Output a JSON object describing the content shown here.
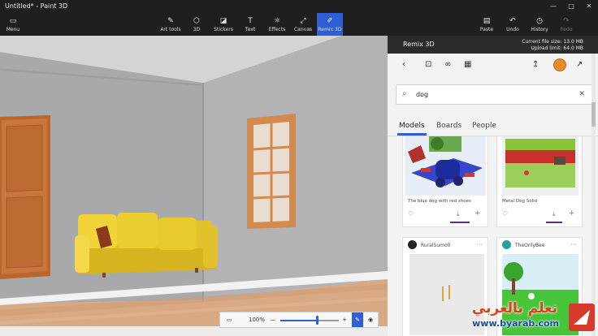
{
  "window": {
    "title": "Untitled* - Paint 3D",
    "minimize": "—",
    "maximize": "□",
    "close": "✕"
  },
  "toolbar": {
    "menu": {
      "icon": "menu-icon",
      "label": "Menu"
    },
    "items": [
      {
        "id": "art-tools",
        "label": "Art tools",
        "icon": "brush-icon"
      },
      {
        "id": "3d",
        "label": "3D",
        "icon": "cube-icon"
      },
      {
        "id": "stickers",
        "label": "Stickers",
        "icon": "sticker-icon"
      },
      {
        "id": "text",
        "label": "Text",
        "icon": "text-icon"
      },
      {
        "id": "effects",
        "label": "Effects",
        "icon": "sun-icon"
      },
      {
        "id": "canvas",
        "label": "Canvas",
        "icon": "resize-icon"
      },
      {
        "id": "remix",
        "label": "Remix 3D",
        "icon": "remix-icon",
        "active": true
      }
    ],
    "right": [
      {
        "id": "paste",
        "label": "Paste",
        "icon": "paste-icon"
      },
      {
        "id": "undo",
        "label": "Undo",
        "icon": "undo-icon"
      },
      {
        "id": "history",
        "label": "History",
        "icon": "history-icon"
      },
      {
        "id": "redo",
        "label": "Redo",
        "icon": "redo-icon",
        "disabled": true
      }
    ]
  },
  "zoom": {
    "value": "100%",
    "minus": "—",
    "plus": "+",
    "level": 0.62
  },
  "panel": {
    "title": "Remix 3D",
    "file_size": "Current file size: 13.0 MB",
    "upload_limit": "Upload limit: 64.0 MB",
    "search": {
      "value": "dog",
      "placeholder": "Search"
    },
    "tabs": [
      "Models",
      "Boards",
      "People"
    ],
    "selected_tab": "Models",
    "cards": [
      {
        "caption": "The blue dog with red shoes"
      },
      {
        "caption": "Metal Dog Solid"
      },
      {
        "user": "RuralSumo0"
      },
      {
        "user": "TheOnlyBee"
      }
    ]
  },
  "watermark": {
    "arabic": "تعلم بالعربي",
    "url": "www.byarab.com"
  },
  "colors": {
    "accent": "#2f5fd3",
    "download_bar": "#5a2ca0"
  }
}
